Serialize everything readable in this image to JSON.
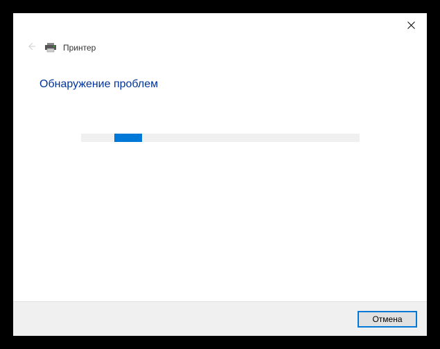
{
  "window": {
    "title": "Принтер"
  },
  "content": {
    "heading": "Обнаружение проблем"
  },
  "footer": {
    "cancel_label": "Отмена"
  },
  "progress": {
    "indeterminate": true
  },
  "colors": {
    "accent": "#0078d7",
    "heading": "#003399"
  }
}
